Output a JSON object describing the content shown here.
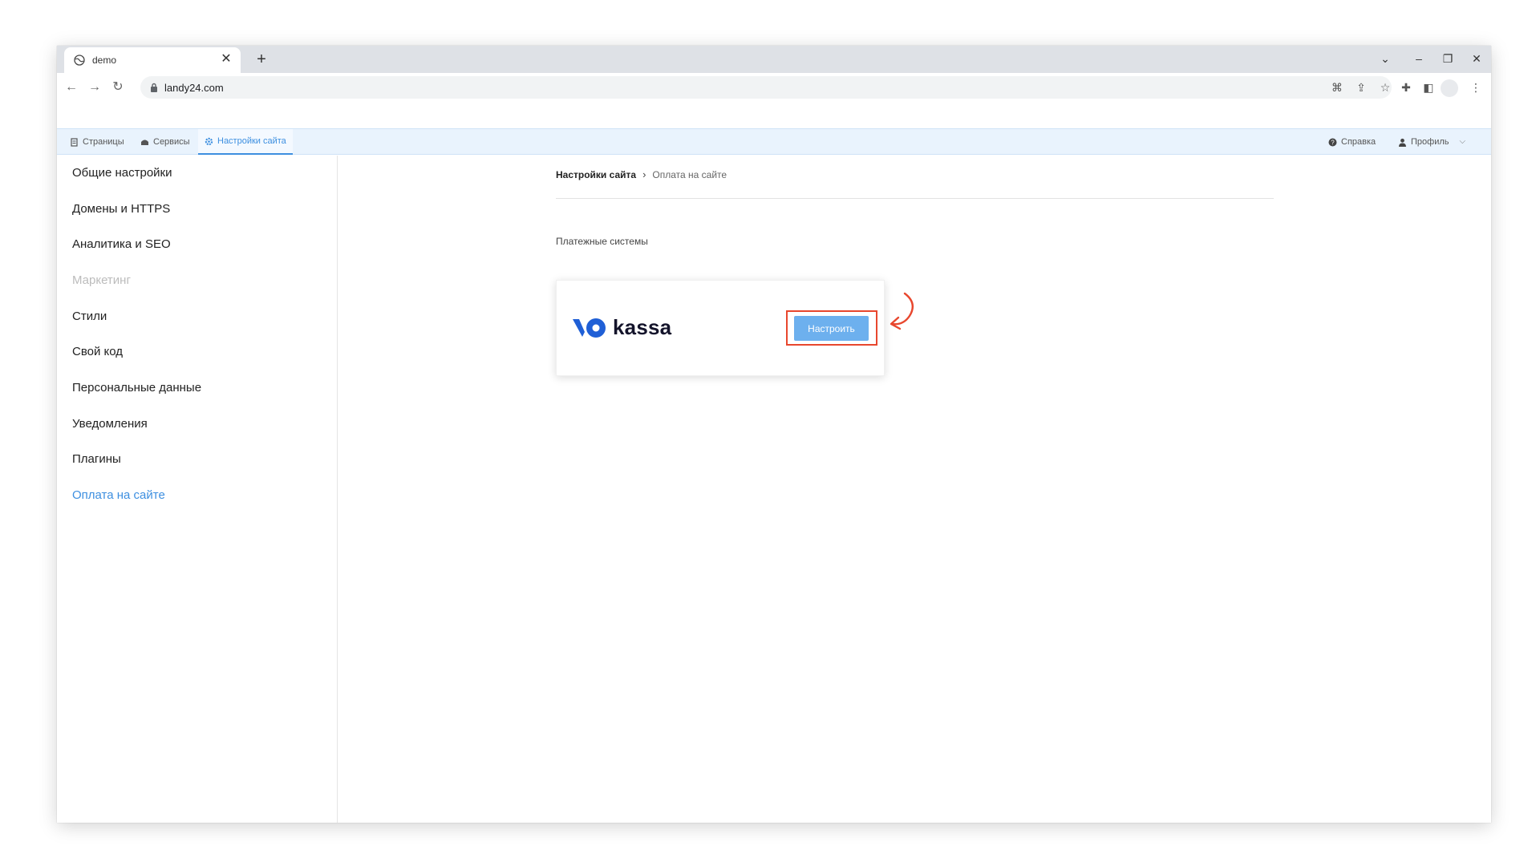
{
  "browser": {
    "tab_title": "demo",
    "url": "landy24.com"
  },
  "appnav": {
    "items": [
      "Страницы",
      "Сервисы",
      "Настройки сайта"
    ],
    "active": "Настройки сайта",
    "help_label": "Справка",
    "profile_label": "Профиль"
  },
  "sidebar": {
    "items": [
      {
        "label": "Общие настройки",
        "state": "normal"
      },
      {
        "label": "Домены и HTTPS",
        "state": "normal"
      },
      {
        "label": "Аналитика и SEO",
        "state": "normal"
      },
      {
        "label": "Маркетинг",
        "state": "disabled"
      },
      {
        "label": "Стили",
        "state": "normal"
      },
      {
        "label": "Свой код",
        "state": "normal"
      },
      {
        "label": "Персональные данные",
        "state": "normal"
      },
      {
        "label": "Уведомления",
        "state": "normal"
      },
      {
        "label": "Плагины",
        "state": "normal"
      },
      {
        "label": "Оплата на сайте",
        "state": "active"
      }
    ]
  },
  "main": {
    "breadcrumb": {
      "root": "Настройки сайта",
      "current": "Оплата на сайте"
    },
    "section_title": "Платежные системы",
    "card": {
      "logo_text": "kassa",
      "button_label": "Настроить"
    }
  },
  "colors": {
    "accent": "#3d8fe0",
    "button": "#6db0ee",
    "highlight": "#e8472e",
    "logo_blue": "#1f5fd6"
  }
}
